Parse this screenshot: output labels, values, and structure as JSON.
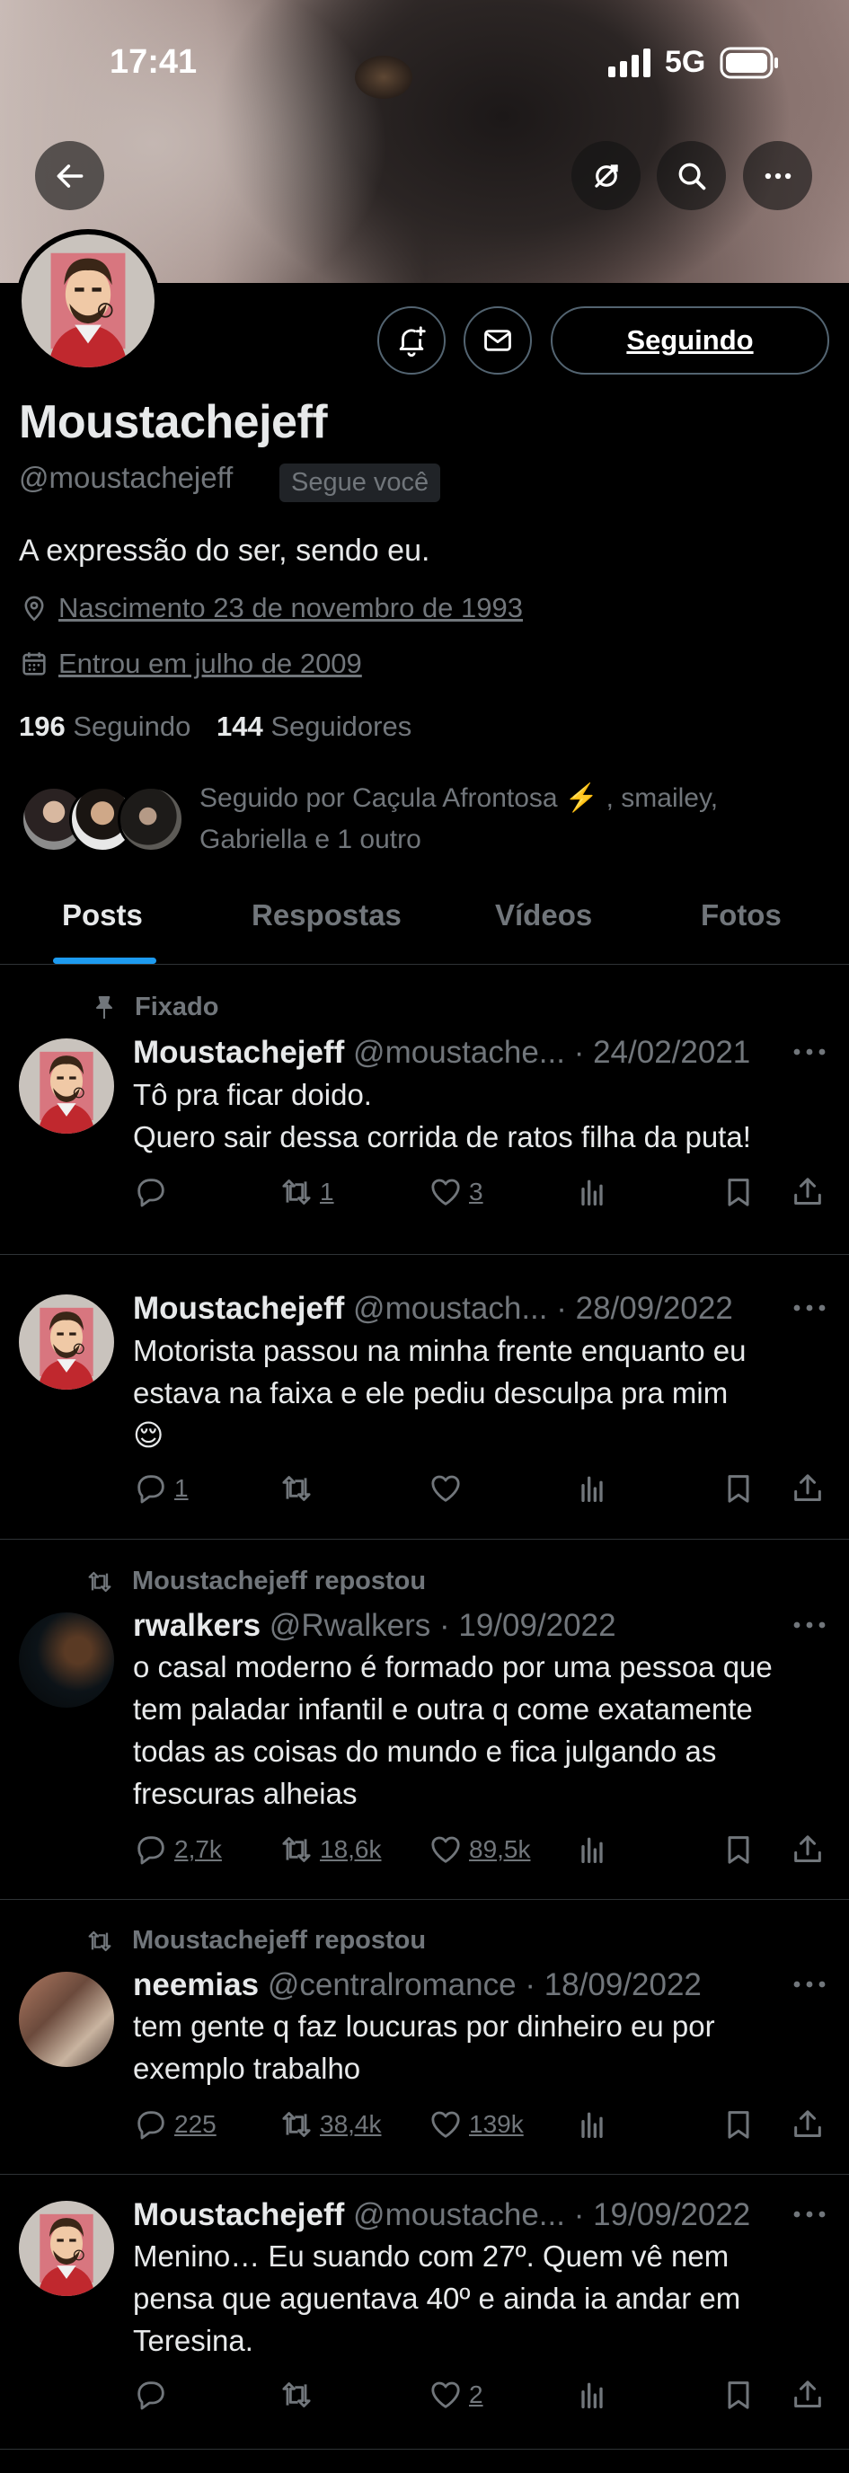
{
  "status_bar": {
    "time": "17:41",
    "network": "5G"
  },
  "header": {
    "back_icon": "arrow-left-icon",
    "translate_icon": "circle-slash-icon",
    "search_icon": "search-icon",
    "more_icon": "more-horizontal-icon"
  },
  "profile": {
    "display_name": "Moustachejeff",
    "handle": "@moustachejeff",
    "follows_you_badge": "Segue você",
    "bio": "A expressão do ser, sendo eu.",
    "birthday": "Nascimento 23 de novembro de 1993",
    "joined": "Entrou em julho de 2009",
    "following_count": "196",
    "following_label": "Seguindo",
    "followers_count": "144",
    "followers_label": "Seguidores",
    "followed_by_line1": "Seguido por Caçula Afrontosa ⚡️ , smailey,",
    "followed_by_line2": "Gabriella e 1 outro",
    "follow_button": "Seguindo"
  },
  "tabs": [
    {
      "label": "Posts",
      "active": true
    },
    {
      "label": "Respostas",
      "active": false
    },
    {
      "label": "Vídeos",
      "active": false
    },
    {
      "label": "Fotos",
      "active": false
    }
  ],
  "posts": [
    {
      "context": "Fixado",
      "name": "Moustachejeff",
      "handle": "@moustache...",
      "date": "· 24/02/2021",
      "lines": [
        "Tô pra ficar doido.",
        "Quero sair dessa corrida de ratos filha da puta!"
      ],
      "replies": "",
      "reposts": "1",
      "likes": "3"
    },
    {
      "context": "",
      "name": "Moustachejeff",
      "handle": "@moustach...",
      "date": "· 28/09/2022",
      "lines": [
        "Motorista passou na minha frente enquanto eu",
        "estava na faixa e ele pediu desculpa pra mim",
        "😌"
      ],
      "replies": "1",
      "reposts": "",
      "likes": ""
    },
    {
      "context": "Moustachejeff repostou",
      "name": "rwalkers",
      "handle": "@Rwalkers",
      "date": "· 19/09/2022",
      "lines": [
        "o casal moderno é formado por uma pessoa que",
        "tem paladar infantil e outra q come exatamente",
        "todas as coisas do mundo e fica julgando as",
        "frescuras alheias"
      ],
      "replies": "2,7k",
      "reposts": "18,6k",
      "likes": "89,5k"
    },
    {
      "context": "Moustachejeff repostou",
      "name": "neemias",
      "handle": "@centralromance",
      "date": "· 18/09/2022",
      "lines": [
        "tem gente q faz loucuras por dinheiro eu por",
        "exemplo trabalho"
      ],
      "replies": "225",
      "reposts": "38,4k",
      "likes": "139k"
    },
    {
      "context": "",
      "name": "Moustachejeff",
      "handle": "@moustache...",
      "date": "· 19/09/2022",
      "lines": [
        "Menino… Eu suando com 27º. Quem vê nem",
        "pensa que aguentava 40º e ainda ia andar em",
        "Teresina."
      ],
      "replies": "",
      "reposts": "",
      "likes": "2"
    }
  ]
}
